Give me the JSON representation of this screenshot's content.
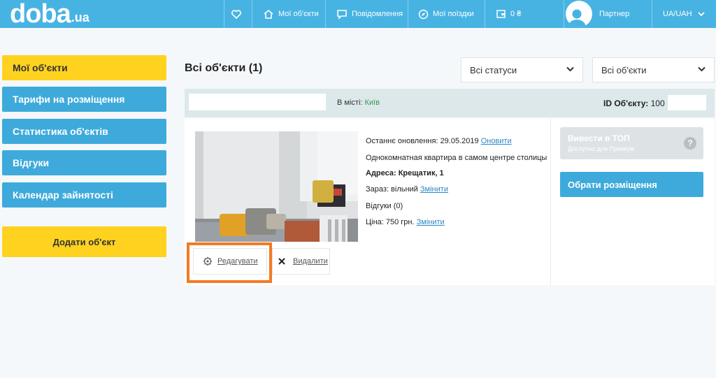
{
  "header": {
    "logo_main": "doba",
    "logo_tld": ".ua",
    "my_objects": "Мої об'єкти",
    "messages": "Повідомлення",
    "my_trips": "Мої поїздки",
    "wallet": "0 ₴",
    "partner": "Партнер",
    "locale": "UA/UAH"
  },
  "sidebar": {
    "items": [
      {
        "label": "Мої об'єкти"
      },
      {
        "label": "Тарифи на розміщення"
      },
      {
        "label": "Статистика об'єктів"
      },
      {
        "label": "Відгуки"
      },
      {
        "label": "Календар зайнятості"
      }
    ],
    "add_button": "Додати об'єкт"
  },
  "main": {
    "title": "Всі об'єкти (1)",
    "status_select": "Всі статуси",
    "objects_select": "Всі об'єкти",
    "filter": {
      "search_value": "",
      "city_label": "В місті:",
      "city_value": "Київ",
      "id_label": "ID Об'єкту:",
      "id_value": "100"
    }
  },
  "listing": {
    "updated_label": "Останнє оновлення: 29.05.2019",
    "update_link": "Оновити",
    "description": "Однокомнатная квартира в самом центре столицы",
    "address": "Адреса: Крещатик, 1",
    "status_label": "Зараз: вільний",
    "change_link": "Змінити",
    "reviews": "Відгуки (0)",
    "price_label": "Ціна: 750 грн.",
    "price_link": "Змінити",
    "top_title": "Вивести в ТОП",
    "top_subtitle": "Доступно для Преміум",
    "top_help": "?",
    "choose_button": "Обрати розміщення",
    "edit_button": "Редагувати",
    "delete_button": "Видалити"
  },
  "colors": {
    "header_bg": "#47b3e3",
    "accent_yellow": "#ffd21f",
    "button_blue": "#3eaadb",
    "highlight_orange": "#f47a24"
  }
}
